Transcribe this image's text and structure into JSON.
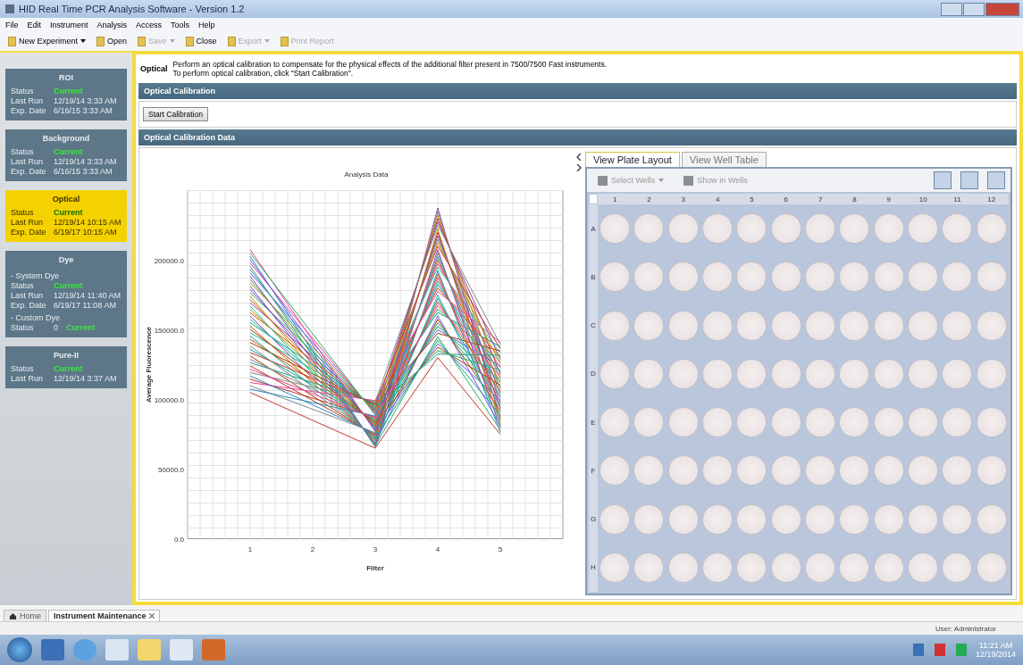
{
  "window": {
    "title": "HID Real Time PCR Analysis Software - Version 1.2"
  },
  "menu": [
    "File",
    "Edit",
    "Instrument",
    "Analysis",
    "Access",
    "Tools",
    "Help"
  ],
  "toolbar": [
    {
      "label": "New Experiment",
      "kind": "dropdown",
      "disabled": false
    },
    {
      "label": "Open",
      "kind": "button",
      "disabled": false
    },
    {
      "label": "Save",
      "kind": "dropdown",
      "disabled": true
    },
    {
      "label": "Close",
      "kind": "button",
      "disabled": false
    },
    {
      "label": "Export",
      "kind": "dropdown",
      "disabled": true
    },
    {
      "label": "Print Report",
      "kind": "button",
      "disabled": true
    }
  ],
  "sidebar": [
    {
      "title": "ROI",
      "selected": false,
      "rows": [
        {
          "kind": "status",
          "label": "Status",
          "value": "Current"
        },
        {
          "kind": "field",
          "label": "Last Run",
          "value": "12/19/14 3:33 AM"
        },
        {
          "kind": "field",
          "label": "Exp. Date",
          "value": "6/16/15 3:33 AM"
        }
      ]
    },
    {
      "title": "Background",
      "selected": false,
      "rows": [
        {
          "kind": "status",
          "label": "Status",
          "value": "Current"
        },
        {
          "kind": "field",
          "label": "Last Run",
          "value": "12/19/14 3:33 AM"
        },
        {
          "kind": "field",
          "label": "Exp. Date",
          "value": "6/16/15 3:33 AM"
        }
      ]
    },
    {
      "title": "Optical",
      "selected": true,
      "rows": [
        {
          "kind": "status",
          "label": "Status",
          "value": "Current"
        },
        {
          "kind": "field",
          "label": "Last Run",
          "value": "12/19/14 10:15 AM"
        },
        {
          "kind": "field",
          "label": "Exp. Date",
          "value": "6/19/17 10:15 AM"
        }
      ]
    },
    {
      "title": "Dye",
      "selected": false,
      "rows": [
        {
          "kind": "section",
          "label": "- System Dye"
        },
        {
          "kind": "status",
          "label": "Status",
          "value": "Current"
        },
        {
          "kind": "field",
          "label": "Last Run",
          "value": "12/19/14 11:40 AM"
        },
        {
          "kind": "field",
          "label": "Exp. Date",
          "value": "6/19/17 11:08 AM"
        },
        {
          "kind": "section",
          "label": "- Custom Dye"
        },
        {
          "kind": "status",
          "label": "Status",
          "value": "Current",
          "count": "0"
        }
      ]
    },
    {
      "title": "Pure-II",
      "selected": false,
      "rows": [
        {
          "kind": "status",
          "label": "Status",
          "value": "Current"
        },
        {
          "kind": "field",
          "label": "Last Run",
          "value": "12/19/14 3:37 AM"
        }
      ]
    }
  ],
  "intro": {
    "label": "Optical",
    "lines": [
      "Perform an optical calibration to compensate for the physical effects of the additional filter present in 7500/7500 Fast instruments.",
      "To perform optical calibration, click \"Start Calibration\"."
    ]
  },
  "calibration": {
    "header": "Optical Calibration",
    "button": "Start Calibration"
  },
  "data": {
    "header": "Optical Calibration Data",
    "chart": {
      "title": "Analysis Data",
      "ylabel": "Average Fluorescence",
      "xlabel": "Filter",
      "xticks": [
        "1",
        "2",
        "3",
        "4",
        "5"
      ],
      "yticks": [
        "200000.0",
        "150000.0",
        "100000.0",
        "50000.0",
        "0.0"
      ]
    },
    "plate": {
      "tabs": [
        {
          "label": "View Plate Layout",
          "selected": true
        },
        {
          "label": "View Well Table",
          "selected": false
        }
      ],
      "select": "Select Wells",
      "show": "Show in Wells",
      "columns": [
        "1",
        "2",
        "3",
        "4",
        "5",
        "6",
        "7",
        "8",
        "9",
        "10",
        "11",
        "12"
      ],
      "rows": [
        "A",
        "B",
        "C",
        "D",
        "E",
        "F",
        "G",
        "H"
      ]
    }
  },
  "bottom_tabs": [
    {
      "label": "Home",
      "selected": false,
      "closable": false
    },
    {
      "label": "Instrument Maintenance",
      "selected": true,
      "closable": true
    }
  ],
  "status_bar": "User: Administrator",
  "taskbar": {
    "time": "11:21 AM",
    "date": "12/19/2014"
  }
}
